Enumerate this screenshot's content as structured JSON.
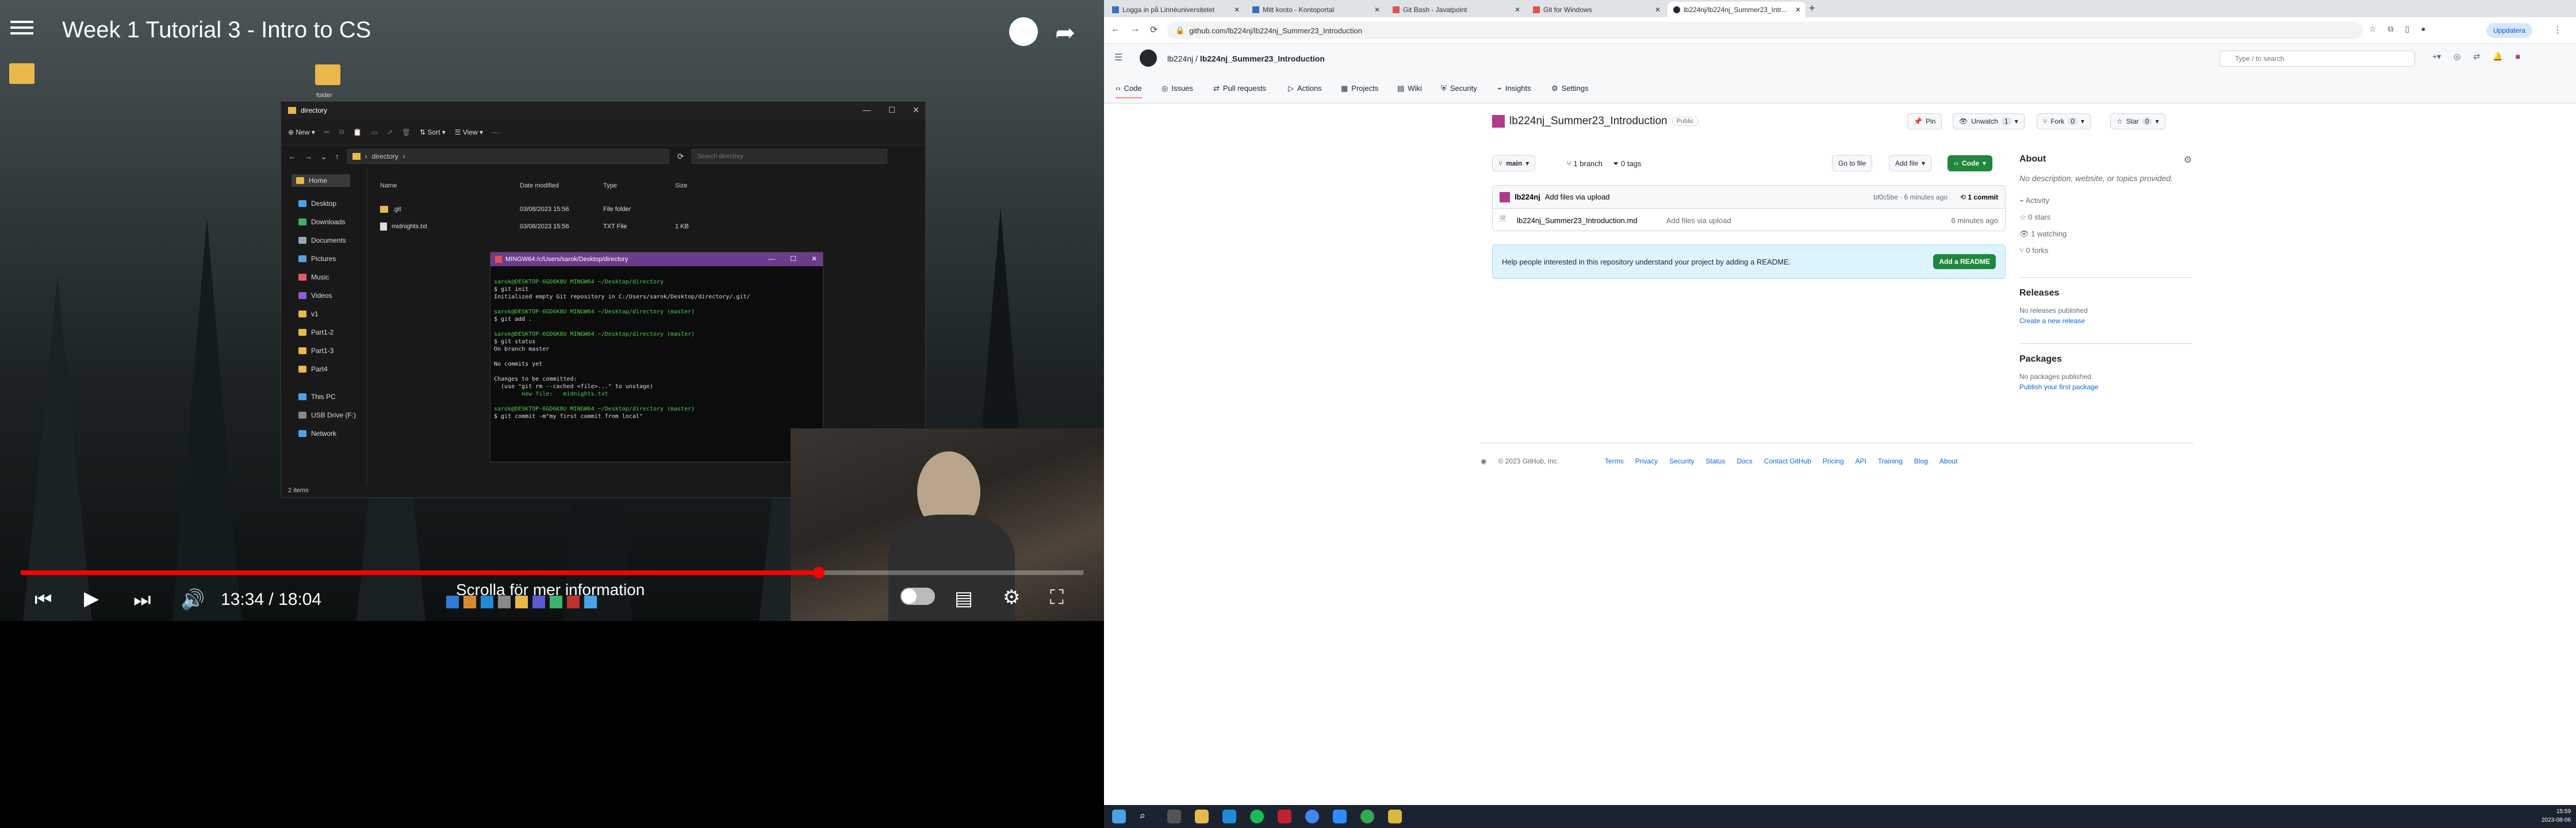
{
  "video": {
    "title": "Week 1 Tutorial 3 - Intro to CS",
    "time_current": "13:34",
    "time_total": "18:04",
    "progress_fraction": 0.751,
    "scroll_hint": "Scrolla för mer information",
    "desktop_icon_label": "folder"
  },
  "explorer": {
    "title": "directory",
    "new_label": "New",
    "sort_label": "Sort",
    "view_label": "View",
    "breadcrumb": "directory",
    "search_placeholder": "Search directory",
    "columns": [
      "Name",
      "Date modified",
      "Type",
      "Size"
    ],
    "files": [
      {
        "name": ".git",
        "date": "03/08/2023 15:56",
        "type": "File folder",
        "size": ""
      },
      {
        "name": "midnights.txt",
        "date": "03/08/2023 15:56",
        "type": "TXT File",
        "size": "1 KB"
      }
    ],
    "nav": [
      "Home",
      "Desktop",
      "Downloads",
      "Documents",
      "Pictures",
      "Music",
      "Videos",
      "v1",
      "Part1-2",
      "Part1-3",
      "Part4",
      "This PC",
      "USB Drive (F:)",
      "Network"
    ],
    "status": "2 items"
  },
  "terminal": {
    "title": "MINGW64:/c/Users/sarok/Desktop/directory",
    "lines": [
      {
        "t": "sarok@DESKTOP-6GD6K8U MINGW64 ~/Desktop/directory",
        "c": "g"
      },
      {
        "t": "$ git init",
        "c": ""
      },
      {
        "t": "Initialized empty Git repository in C:/Users/sarok/Desktop/directory/.git/",
        "c": ""
      },
      {
        "t": "",
        "c": ""
      },
      {
        "t": "sarok@DESKTOP-6GD6K8U MINGW64 ~/Desktop/directory (master)",
        "c": "g"
      },
      {
        "t": "$ git add .",
        "c": ""
      },
      {
        "t": "",
        "c": ""
      },
      {
        "t": "sarok@DESKTOP-6GD6K8U MINGW64 ~/Desktop/directory (master)",
        "c": "g"
      },
      {
        "t": "$ git status",
        "c": ""
      },
      {
        "t": "On branch master",
        "c": ""
      },
      {
        "t": "",
        "c": ""
      },
      {
        "t": "No commits yet",
        "c": ""
      },
      {
        "t": "",
        "c": ""
      },
      {
        "t": "Changes to be committed:",
        "c": ""
      },
      {
        "t": "  (use \"git rm --cached <file>...\" to unstage)",
        "c": ""
      },
      {
        "t": "        new file:   midnights.txt",
        "c": "g"
      },
      {
        "t": "",
        "c": ""
      },
      {
        "t": "sarok@DESKTOP-6GD6K8U MINGW64 ~/Desktop/directory (master)",
        "c": "g"
      },
      {
        "t": "$ git commit -m\"my first commit from local\"",
        "c": ""
      }
    ]
  },
  "browser": {
    "tabs": [
      "Logga in på Linnéuniversitetet",
      "Mitt konto - Kontoportal",
      "Git Bash - Javatpoint",
      "Git for Windows",
      "lb224nj/lb224nj_Summer23_Intr..."
    ],
    "url": "github.com/lb224nj/lb224nj_Summer23_Introduction",
    "update_label": "Uppdatera"
  },
  "github": {
    "owner": "lb224nj",
    "repo": "lb224nj_Summer23_Introduction",
    "search_placeholder": "Type / to search",
    "tabs": [
      "Code",
      "Issues",
      "Pull requests",
      "Actions",
      "Projects",
      "Wiki",
      "Security",
      "Insights",
      "Settings"
    ],
    "visibility": "Public",
    "pin_label": "Pin",
    "unwatch_label": "Unwatch",
    "unwatch_count": "1",
    "fork_label": "Fork",
    "fork_count": "0",
    "star_label": "Star",
    "star_count": "0",
    "branch": "main",
    "branch_count": "1 branch",
    "tag_count": "0 tags",
    "go_to_file": "Go to file",
    "add_file": "Add file",
    "code_button": "Code",
    "commit_author": "lb224nj",
    "commit_message": "Add files via upload",
    "commit_hash_time": "bf0c5be · 6 minutes ago",
    "commit_count": "1 commit",
    "files": [
      {
        "name": "lb224nj_Summer23_Introduction.md",
        "msg": "Add files via upload",
        "time": "6 minutes ago"
      }
    ],
    "readme_prompt": "Help people interested in this repository understand your project by adding a README.",
    "add_readme": "Add a README",
    "about_title": "About",
    "about_desc": "No description, website, or topics provided.",
    "about_items": [
      "Activity",
      "0 stars",
      "1 watching",
      "0 forks"
    ],
    "releases_title": "Releases",
    "releases_none": "No releases published",
    "releases_link": "Create a new release",
    "packages_title": "Packages",
    "packages_none": "No packages published",
    "packages_link": "Publish your first package",
    "footer_copy": "© 2023 GitHub, Inc.",
    "footer_links": [
      "Terms",
      "Privacy",
      "Security",
      "Status",
      "Docs",
      "Contact GitHub",
      "Pricing",
      "API",
      "Training",
      "Blog",
      "About"
    ]
  },
  "taskbar": {
    "time": "15:59",
    "date": "2023-08-06"
  }
}
